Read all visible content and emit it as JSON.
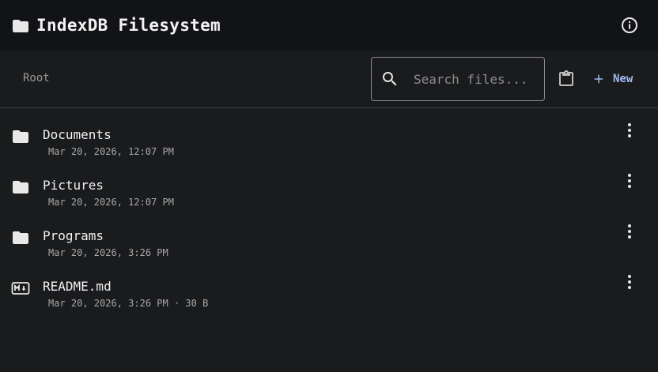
{
  "header": {
    "title": "IndexDB Filesystem",
    "icon": "folder-icon",
    "info_icon": "info-icon"
  },
  "toolbar": {
    "breadcrumb": "Root",
    "search_placeholder": "Search files...",
    "clipboard_icon": "clipboard-icon",
    "new_label": "New",
    "accent_color": "#9fb8ee"
  },
  "files": [
    {
      "name": "Documents",
      "meta": "Mar 20, 2026, 12:07 PM",
      "icon": "folder-icon"
    },
    {
      "name": "Pictures",
      "meta": "Mar 20, 2026, 12:07 PM",
      "icon": "folder-icon"
    },
    {
      "name": "Programs",
      "meta": "Mar 20, 2026, 3:26 PM",
      "icon": "folder-icon"
    },
    {
      "name": "README.md",
      "meta": "Mar 20, 2026, 3:26 PM · 30 B",
      "icon": "markdown-icon"
    }
  ]
}
